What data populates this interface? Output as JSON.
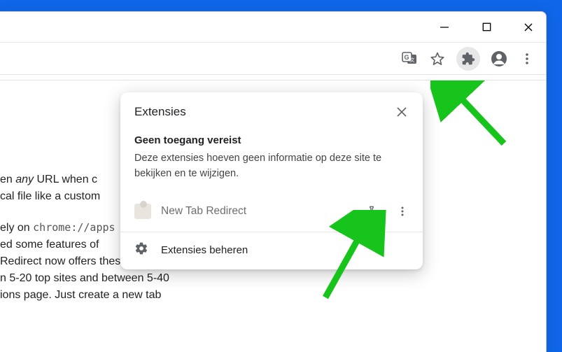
{
  "window_controls": {
    "minimize": "—",
    "maximize": "□",
    "close": "✕"
  },
  "popup": {
    "title": "Extensies",
    "section_heading": "Geen toegang vereist",
    "section_desc": "Deze extensies hoeven geen informatie op deze site te bekijken en te wijzigen.",
    "extension_name": "New Tab Redirect",
    "manage_label": "Extensies beheren"
  },
  "page": {
    "p1_a": "en ",
    "p1_em": "any",
    "p1_b": " URL when c",
    "p1_c": "cal file like a custom",
    "p2_a": "ely on ",
    "p2_code": "chrome://apps",
    "p2_b": "ed some features of ",
    "p2_c": " Redirect now offers these",
    "p2_d": "n 5-20 top sites and between 5-40",
    "p2_e": "ions page. Just create a new tab"
  }
}
